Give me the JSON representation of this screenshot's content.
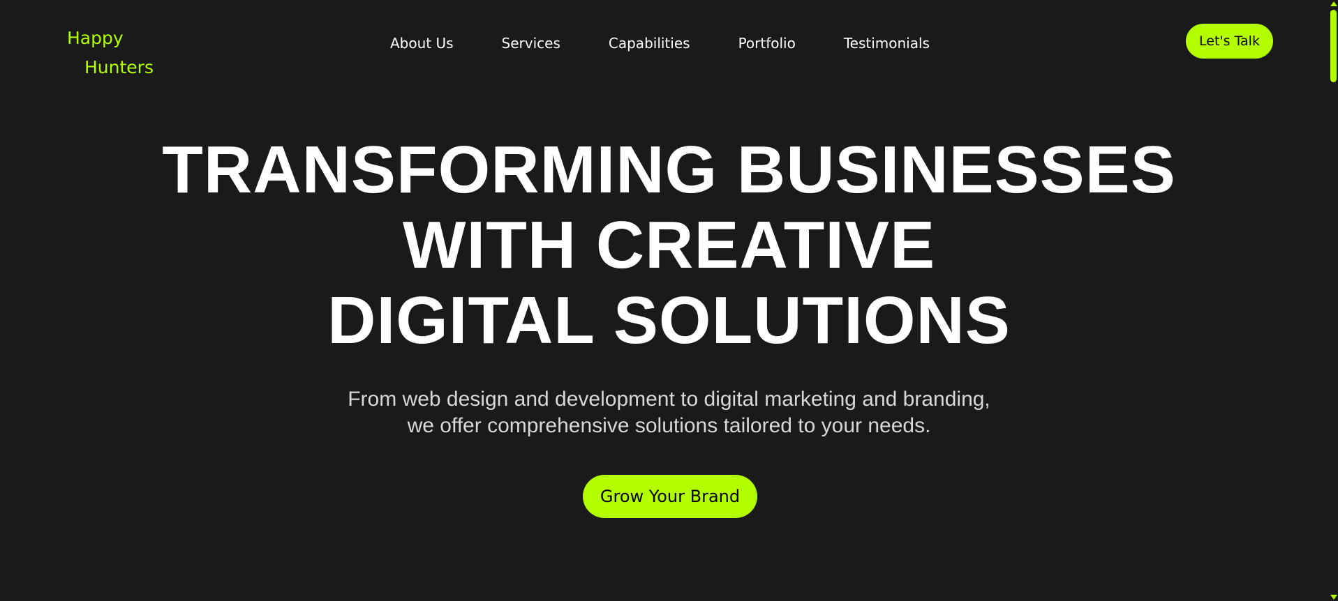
{
  "brand": {
    "logo_line1": "Happy",
    "logo_line2": "Hunters",
    "accent_color": "#b3ff00",
    "background_color": "#1a1a1a"
  },
  "nav": {
    "items": [
      {
        "label": "About Us"
      },
      {
        "label": "Services"
      },
      {
        "label": "Capabilities"
      },
      {
        "label": "Portfolio"
      },
      {
        "label": "Testimonials"
      }
    ],
    "cta_label": "Let's Talk"
  },
  "hero": {
    "title_lines": [
      "TRANSFORMING BUSINESSES",
      "WITH CREATIVE",
      "DIGITAL SOLUTIONS"
    ],
    "subtitle_lines": [
      "From web design and development to digital marketing and branding,",
      "we offer comprehensive solutions tailored to your needs."
    ],
    "cta_label": "Grow Your Brand"
  },
  "scrollbar": {
    "up_icon": "triangle-up-icon",
    "down_icon": "triangle-down-icon"
  }
}
